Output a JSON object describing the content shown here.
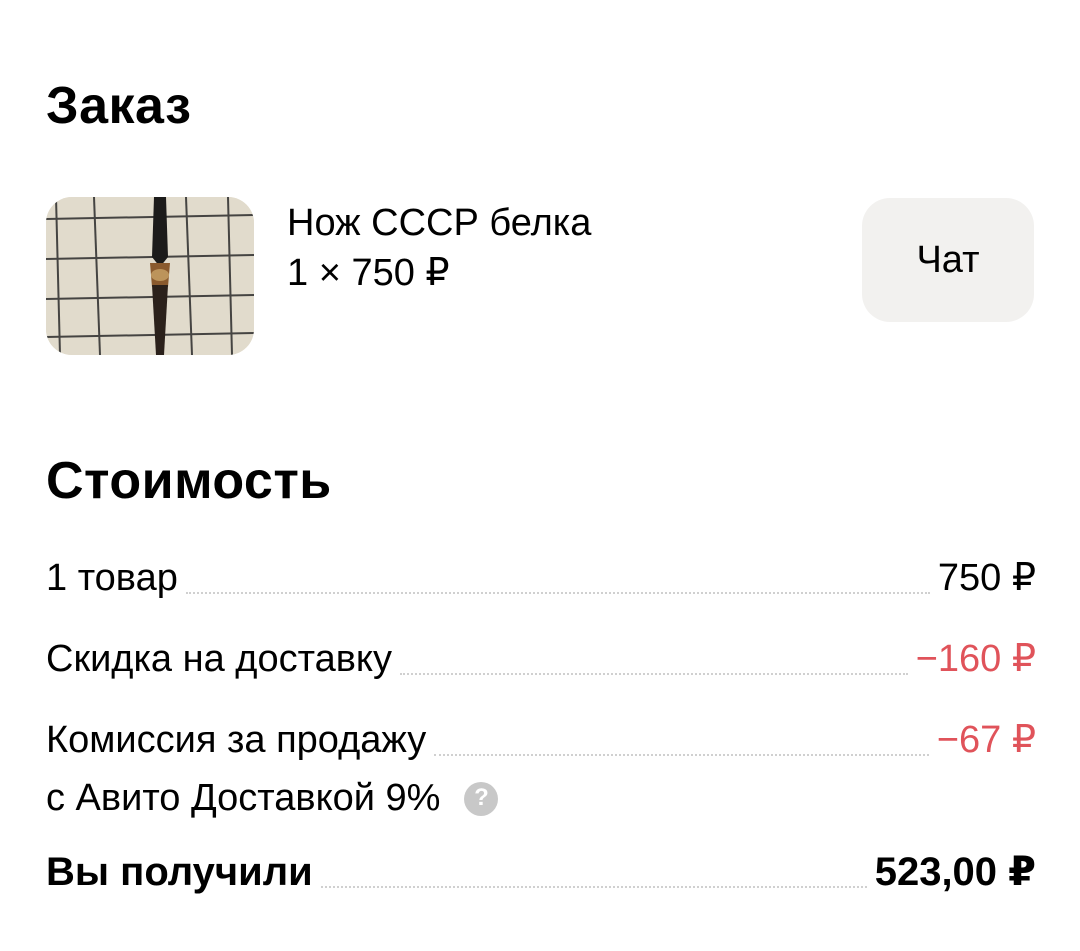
{
  "order": {
    "title": "Заказ",
    "product": {
      "name": "Нож СССР белка",
      "quantity_price": "1 × 750 ₽",
      "thumbnail_icon": "knife-photo"
    },
    "chat_label": "Чат"
  },
  "cost": {
    "title": "Стоимость",
    "items": {
      "label": "1 товар",
      "value": "750 ₽"
    },
    "delivery_discount": {
      "label": "Скидка на доставку",
      "value": "−160 ₽",
      "color": "#e0535a"
    },
    "commission": {
      "label_line1": "Комиссия за продажу",
      "label_line2": "с Авито Доставкой 9%",
      "value": "−67 ₽",
      "color": "#e0535a",
      "help_icon": "question-circle-icon"
    },
    "total": {
      "label": "Вы получили",
      "value": "523,00 ₽"
    }
  }
}
